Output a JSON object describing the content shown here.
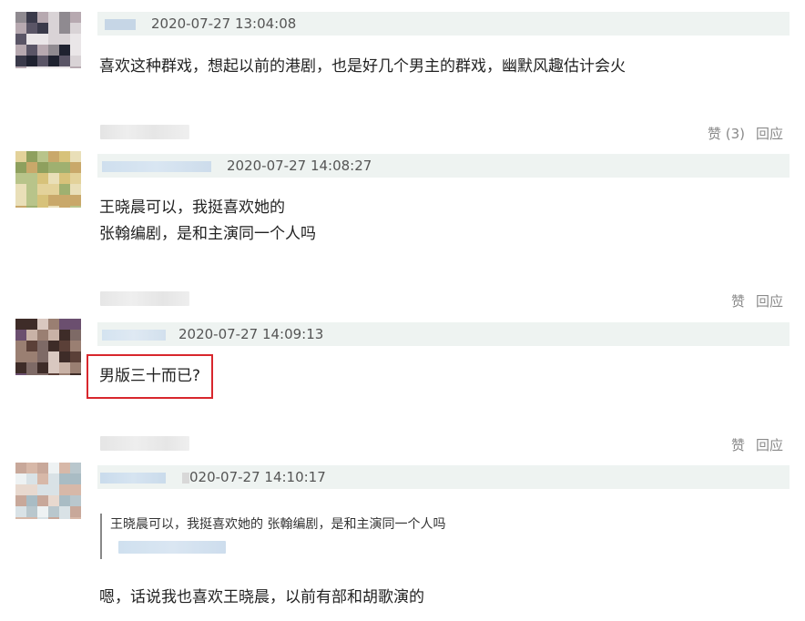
{
  "comments": [
    {
      "timestamp": "2020-07-27 13:04:08",
      "lines": [
        "喜欢这种群戏，想起以前的港剧，也是好几个男主的群戏，幽默风趣估计会火"
      ],
      "like_label": "赞 (3)",
      "reply_label": "回应"
    },
    {
      "timestamp": "2020-07-27 14:08:27",
      "lines": [
        "王晓晨可以，我挺喜欢她的",
        "张翰编剧，是和主演同一个人吗"
      ],
      "like_label": "赞",
      "reply_label": "回应"
    },
    {
      "timestamp": "2020-07-27 14:09:13",
      "lines": [
        "男版三十而已?"
      ],
      "like_label": "赞",
      "reply_label": "回应"
    },
    {
      "timestamp": "020-07-27 14:10:17",
      "quote": "王晓晨可以，我挺喜欢她的 张翰编剧，是和主演同一个人吗",
      "lines": [
        "嗯，话说我也喜欢王晓晨，以前有部和胡歌演的"
      ]
    }
  ],
  "colors": {
    "meta_bar_bg": "#eef3f1",
    "highlight_border": "#d8272d",
    "action_text": "#8a8a8a"
  }
}
